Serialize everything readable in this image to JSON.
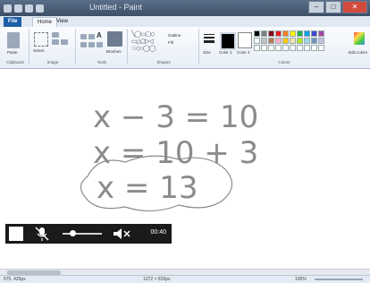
{
  "window": {
    "title": "Untitled - Paint"
  },
  "tabs": {
    "file": "File",
    "home": "Home",
    "view": "View"
  },
  "ribbon": {
    "groups": {
      "clipboard": "Clipboard",
      "image": "Image",
      "tools": "Tools",
      "shapes": "Shapes",
      "colors": "Colors"
    },
    "paste": "Paste",
    "select": "Select",
    "brushes": "Brushes",
    "outline": "Outline",
    "fill": "Fill",
    "size": "Size",
    "color1": "Color 1",
    "color2": "Color 2",
    "edit_colors": "Edit colors"
  },
  "palette": [
    "#000000",
    "#7f7f7f",
    "#880015",
    "#ed1c24",
    "#ff7f27",
    "#fff200",
    "#22b14c",
    "#00a2e8",
    "#3f48cc",
    "#a349a4",
    "#ffffff",
    "#c3c3c3",
    "#b97a57",
    "#ffaec9",
    "#ffc90e",
    "#efe4b0",
    "#b5e61d",
    "#99d9ea",
    "#7092be",
    "#c8bfe7",
    "#ffffff",
    "#ffffff",
    "#ffffff",
    "#ffffff",
    "#ffffff",
    "#ffffff",
    "#ffffff",
    "#ffffff",
    "#ffffff",
    "#ffffff"
  ],
  "canvas": {
    "line1": "x − 3 = 10",
    "line2": "x = 10 + 3",
    "line3": "x = 13"
  },
  "player": {
    "time": "00:40",
    "volume_fraction": 0.25
  },
  "status": {
    "cursor": "575, 429px",
    "dimensions": "1272 × 815px",
    "zoom": "100%"
  }
}
